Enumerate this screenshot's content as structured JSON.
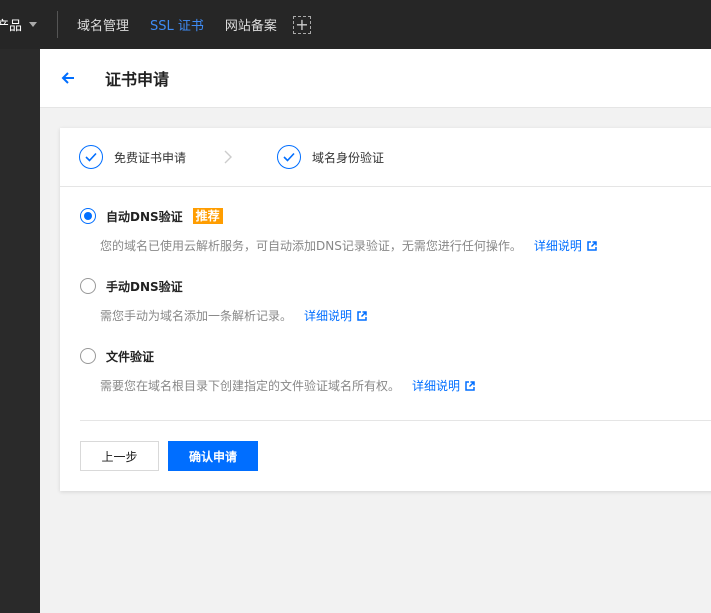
{
  "topbar": {
    "products_label": "产品",
    "nav": [
      "域名管理",
      "SSL 证书",
      "网站备案"
    ],
    "active_index": 1,
    "add_icon": "plus-icon"
  },
  "header": {
    "title": "证书申请",
    "back_icon": "arrow-left-icon"
  },
  "steps": [
    {
      "label": "免费证书申请",
      "icon": "check-circle-icon"
    },
    {
      "label": "域名身份验证",
      "icon": "check-circle-icon"
    }
  ],
  "options": [
    {
      "label": "自动DNS验证",
      "badge": "推荐",
      "checked": true,
      "desc": "您的域名已使用云解析服务，可自动添加DNS记录验证，无需您进行任何操作。",
      "link": "详细说明"
    },
    {
      "label": "手动DNS验证",
      "checked": false,
      "desc": "需您手动为域名添加一条解析记录。",
      "link": "详细说明"
    },
    {
      "label": "文件验证",
      "checked": false,
      "desc": "需要您在域名根目录下创建指定的文件验证域名所有权。",
      "link": "详细说明"
    }
  ],
  "buttons": {
    "prev": "上一步",
    "confirm": "确认申请"
  },
  "colors": {
    "accent": "#006eff",
    "topbar": "#262626",
    "badge": "#ff9d00"
  }
}
